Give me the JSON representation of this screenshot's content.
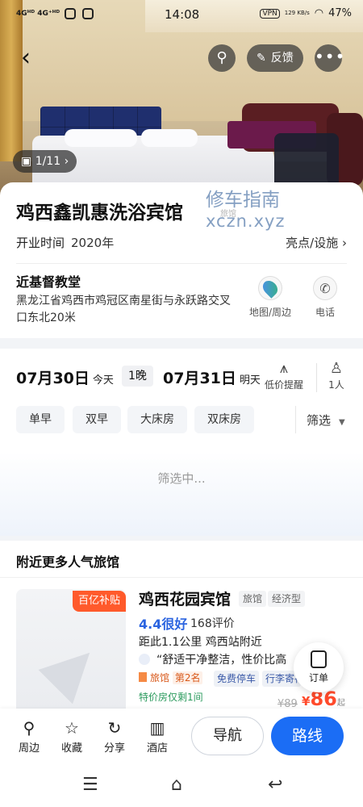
{
  "status_bar": {
    "network": "4Gᴴᴰ 4G⁺ᴴᴰ",
    "time": "14:08",
    "vpn": "VPN",
    "speed": "129 KB/s",
    "battery": "47%"
  },
  "header": {
    "feedback_label": "反馈",
    "photo_count": "1/11",
    "icons": [
      "back-icon",
      "search-icon",
      "edit-icon",
      "more-icon",
      "image-icon"
    ]
  },
  "hotel": {
    "name": "鸡西鑫凯惠洗浴宾馆",
    "watermark_line1": "修车指南",
    "watermark_line2": "xczn.xyz",
    "watermark_tag": "旅馆",
    "open_label": "开业时间",
    "open_year": "2020年",
    "facilities_label": "亮点/设施",
    "landmark": "近基督教堂",
    "address": "黑龙江省鸡西市鸡冠区南星街与永跃路交叉口东北20米",
    "map_label": "地图/周边",
    "phone_label": "电话"
  },
  "booking": {
    "checkin_date": "07月30日",
    "checkin_day": "今天",
    "nights": "1晚",
    "checkout_date": "07月31日",
    "checkout_day": "明天",
    "price_alert_label": "低价提醒",
    "guests": "1人",
    "chips": [
      "单早",
      "双早",
      "大床房",
      "双床房"
    ],
    "filter_label": "筛选",
    "loading_text": "筛选中..."
  },
  "nearby": {
    "section_title": "附近更多人气旅馆",
    "badge": "百亿补贴",
    "name": "鸡西花园宾馆",
    "tags": [
      "旅馆",
      "经济型"
    ],
    "rating": "4.4很好",
    "reviews": "168评价",
    "distance": "距此1.1公里  鸡西站附近",
    "quote": "“舒适干净整洁，性价比高",
    "rank_cat": "旅馆",
    "rank_pos": "第2名",
    "features": [
      "免费停车",
      "行李寄存"
    ],
    "special": "特价房仅剩1间",
    "old_price": "¥89",
    "currency": "¥",
    "price": "86",
    "price_suffix": "起",
    "order_label": "订单"
  },
  "bottom_bar": {
    "tabs": [
      {
        "label": "周边",
        "icon": "search-icon"
      },
      {
        "label": "收藏",
        "icon": "star-icon"
      },
      {
        "label": "分享",
        "icon": "share-icon"
      },
      {
        "label": "酒店",
        "icon": "hotel-icon"
      }
    ],
    "navigate_label": "导航",
    "route_label": "路线"
  }
}
